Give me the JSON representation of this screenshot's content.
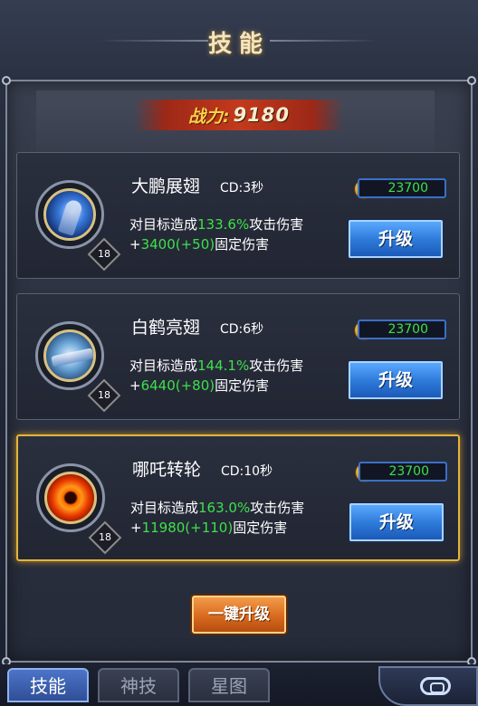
{
  "header": {
    "title": "技能"
  },
  "power": {
    "label": "战力:",
    "value": "9180"
  },
  "skills": [
    {
      "name": "大鹏展翅",
      "cd": "CD:3秒",
      "level": "18",
      "icon": "blue-bird-skill-icon",
      "cost": "23700",
      "desc_prefix": "对目标造成",
      "percent": "133.6%",
      "desc_mid": "攻击伤害",
      "plus": "+",
      "flat": "3400(+50)",
      "desc_suffix": "固定伤害",
      "button": "升级"
    },
    {
      "name": "白鹤亮翅",
      "cd": "CD:6秒",
      "level": "18",
      "icon": "white-crane-skill-icon",
      "cost": "23700",
      "desc_prefix": "对目标造成",
      "percent": "144.1%",
      "desc_mid": "攻击伤害",
      "plus": "+",
      "flat": "6440(+80)",
      "desc_suffix": "固定伤害",
      "button": "升级"
    },
    {
      "name": "哪吒转轮",
      "cd": "CD:10秒",
      "level": "18",
      "icon": "fire-wheel-skill-icon",
      "cost": "23700",
      "desc_prefix": "对目标造成",
      "percent": "163.0%",
      "desc_mid": "攻击伤害",
      "plus": "+",
      "flat": "11980(+110)",
      "desc_suffix": "固定伤害",
      "button": "升级"
    }
  ],
  "onekey_button": "一键升级",
  "tabs": [
    {
      "label": "技能",
      "active": true
    },
    {
      "label": "神技",
      "active": false
    },
    {
      "label": "星图",
      "active": false
    }
  ],
  "colors": {
    "accent_green": "#3ee04a",
    "upgrade_blue": "#2f7cdb",
    "onekey_orange": "#d86a1e",
    "selected_gold": "#e3b53a"
  }
}
